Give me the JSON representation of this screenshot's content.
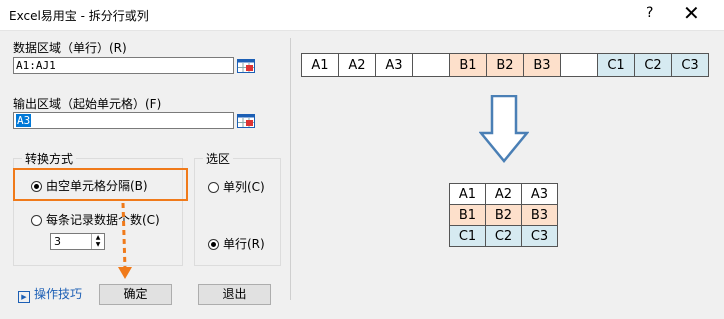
{
  "window": {
    "title": "Excel易用宝 - 拆分行或列",
    "help_label": "?",
    "close_label": "✕"
  },
  "data_range": {
    "label": "数据区域（单行）(R)",
    "value": "A1:AJ1"
  },
  "output_range": {
    "label": "输出区域（起始单元格）(F)",
    "value": "A3"
  },
  "convert_mode": {
    "title": "转换方式",
    "option_blank": "由空单元格分隔(B)",
    "option_count": "每条记录数据个数(C)",
    "count_value": "3",
    "selected": "option_blank"
  },
  "selection": {
    "title": "选区",
    "option_column": "单列(C)",
    "option_row": "单行(R)",
    "selected": "option_row"
  },
  "buttons": {
    "tips": "操作技巧",
    "ok": "确定",
    "cancel": "退出"
  },
  "preview": {
    "source_row": [
      "A1",
      "A2",
      "A3",
      "",
      "B1",
      "B2",
      "B3",
      "",
      "C1",
      "C2",
      "C3"
    ],
    "result_rows": [
      [
        "A1",
        "A2",
        "A3"
      ],
      [
        "B1",
        "B2",
        "B3"
      ],
      [
        "C1",
        "C2",
        "C3"
      ]
    ]
  },
  "colors": {
    "a_group": "#ffffff",
    "b_group": "#fde0cb",
    "c_group": "#d6eaf1",
    "highlight": "#f07a1a",
    "arrow": "#4a7fb5"
  }
}
